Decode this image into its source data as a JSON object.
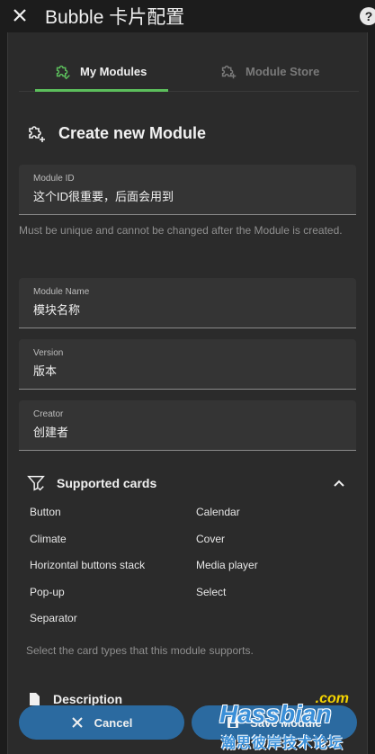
{
  "header": {
    "title": "Bubble 卡片配置",
    "help_glyph": "?"
  },
  "tabs": [
    {
      "label": "My Modules",
      "active": true
    },
    {
      "label": "Module Store",
      "active": false
    }
  ],
  "create": {
    "title": "Create new Module"
  },
  "fields": {
    "module_id": {
      "label": "Module ID",
      "value": "这个ID很重要，后面会用到"
    },
    "module_id_helper": "Must be unique and cannot be changed after the Module is created.",
    "module_name": {
      "label": "Module Name",
      "value": "模块名称"
    },
    "version": {
      "label": "Version",
      "value": "版本"
    },
    "creator": {
      "label": "Creator",
      "value": "创建者"
    }
  },
  "supported": {
    "title": "Supported cards",
    "cards": [
      "Button",
      "Calendar",
      "Climate",
      "Cover",
      "Horizontal buttons stack",
      "Media player",
      "Pop-up",
      "Select",
      "Separator"
    ],
    "helper": "Select the card types that this module supports."
  },
  "description": {
    "title": "Description"
  },
  "actions": {
    "cancel": "Cancel",
    "save": "Save Module"
  },
  "watermark": {
    "com": ".com",
    "main": "Hassbian",
    "sub": "瀚思彼岸技术论坛"
  },
  "colors": {
    "accent_green": "#5cbf5c",
    "button_blue": "#2b6aa0",
    "background": "#1c1c1c",
    "panel": "#2b2b2b"
  }
}
